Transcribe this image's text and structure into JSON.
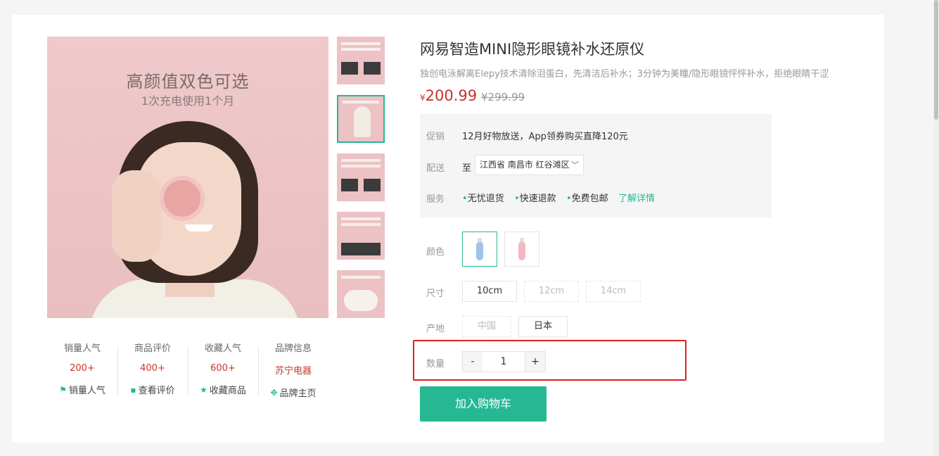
{
  "product": {
    "title": "网易智造MINI隐形眼镜补水还原仪",
    "description": "独创电泳解离Elepy技术清除泪蛋白，先清洁后补水；3分钟为美瞳/隐形眼镜怦怦补水，拒绝眼睛干涩",
    "price_symbol": "¥",
    "price": "200.99",
    "old_price": "¥299.99"
  },
  "gallery": {
    "headline": "高颜值双色可选",
    "subline": "1次充电使用1个月"
  },
  "stats": [
    {
      "title": "销量人气",
      "value": "200+",
      "link": "销量人气",
      "icon": "flag-icon"
    },
    {
      "title": "商品评价",
      "value": "400+",
      "link": "查看评价",
      "icon": "comment-icon"
    },
    {
      "title": "收藏人气",
      "value": "600+",
      "link": "收藏商品",
      "icon": "star-icon"
    },
    {
      "title": "品牌信息",
      "value": "苏宁电器",
      "link": "品牌主页",
      "icon": "brand-icon"
    }
  ],
  "promo": {
    "label": "促销",
    "text": "12月好物放送，App领券购买直降120元"
  },
  "delivery": {
    "label": "配送",
    "prefix": "至",
    "address": "江西省 南昌市 红谷滩区"
  },
  "service": {
    "label": "服务",
    "items": [
      "无忧退货",
      "快速退款",
      "免费包邮"
    ],
    "more": "了解详情"
  },
  "color": {
    "label": "颜色",
    "options": [
      "blue",
      "pink"
    ],
    "accent": "#26b893"
  },
  "size": {
    "label": "尺寸",
    "options": [
      "10cm",
      "12cm",
      "14cm"
    ]
  },
  "origin": {
    "label": "产地",
    "options": [
      "中国",
      "日本"
    ]
  },
  "quantity": {
    "label": "数量",
    "minus": "-",
    "value": "1",
    "plus": "+"
  },
  "cart": {
    "label": "加入购物车"
  }
}
